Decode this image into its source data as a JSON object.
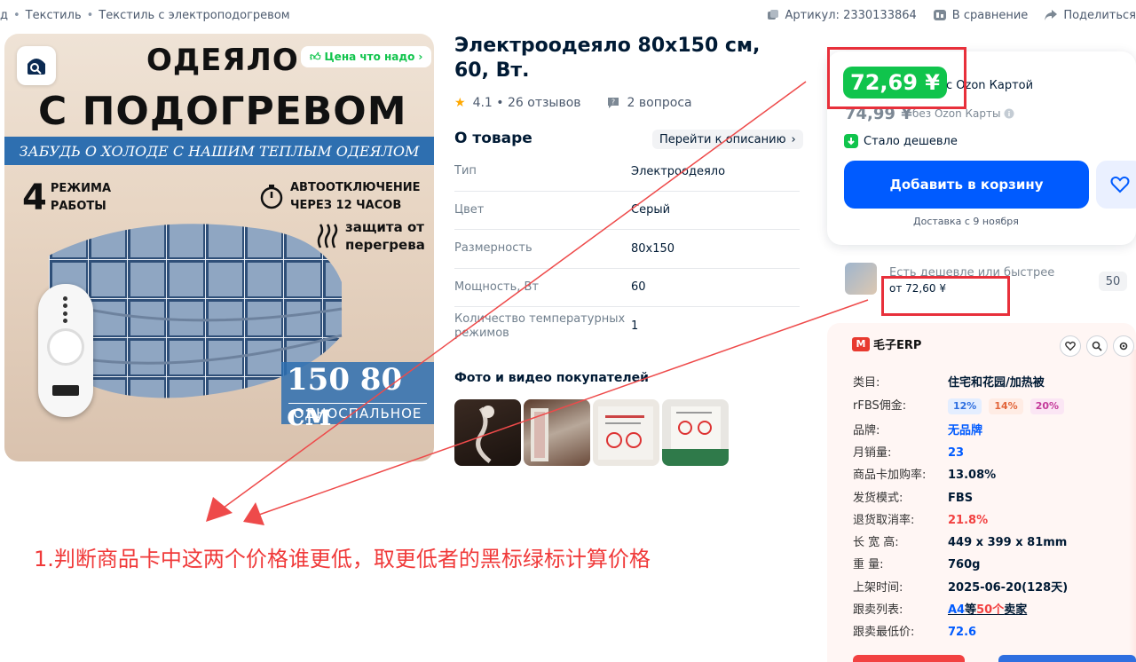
{
  "breadcrumb": {
    "items": [
      "д",
      "Текстиль",
      "Текстиль с электроподогревом"
    ]
  },
  "topbar": {
    "article": "Артикул: 2330133864",
    "compare": "В сравнение",
    "share": "Поделиться"
  },
  "hero": {
    "good_price": "Цена что надо",
    "headline_1": "ОДЕЯЛО",
    "headline_2": "С ПОДОГРЕВОМ",
    "band": "ЗАБУДЬ О ХОЛОДЕ С НАШИМ ТЕПЛЫМ ОДЕЯЛОМ",
    "modes_num": "4",
    "modes_text_1": "РЕЖИМА",
    "modes_text_2": "РАБОТЫ",
    "timer_1": "АВТООТКЛЮЧЕНИЕ",
    "timer_2": "ЧЕРЕЗ 12 ЧАСОВ",
    "protect_1": "защита от",
    "protect_2": "перегрева",
    "size": "150  80 см",
    "size_label": "ОДНОСПАЛЬНОЕ"
  },
  "product": {
    "title": "Электроодеяло 80х150 см, 60, Вт.",
    "rating": "4.1 • 26 отзывов",
    "questions": "2 вопроса",
    "about_heading": "О товаре",
    "to_description": "Перейти к описанию",
    "specs": [
      {
        "k": "Тип",
        "v": "Электроодеяло"
      },
      {
        "k": "Цвет",
        "v": "Серый"
      },
      {
        "k": "Размерность",
        "v": "80x150"
      },
      {
        "k": "Мощность, Вт",
        "v": "60"
      },
      {
        "k": "Количество температурных режимов",
        "v": "1"
      }
    ],
    "photos_heading": "Фото и видео покупателей"
  },
  "pricing": {
    "card_price": "72,69 ¥",
    "card_label": "с Ozon Картой",
    "old_price": "74,99 ¥",
    "old_label": "без Ozon Карты",
    "cheaper": "Стало дешевле",
    "add_to_cart": "Добавить в корзину",
    "delivery": "Доставка с 9 ноября"
  },
  "alternatives": {
    "title": "Есть дешевле или быстрее",
    "from_price": "от 72,60 ¥",
    "count": "50"
  },
  "erp": {
    "brand": "毛子ERP",
    "rows": [
      {
        "k": "类目:",
        "v": "住宅和花园/加热被"
      },
      {
        "k": "rFBS佣金:",
        "tags": [
          "12%",
          "14%",
          "20%"
        ]
      },
      {
        "k": "品牌:",
        "v": "无品牌"
      },
      {
        "k": "月销量:",
        "v": "23"
      },
      {
        "k": "商品卡加购率:",
        "v": "13.08%"
      },
      {
        "k": "发货模式:",
        "v": "FBS"
      },
      {
        "k": "退货取消率:",
        "v": "21.8%"
      },
      {
        "k": "长 宽 高:",
        "v": "449 x 399 x 81mm"
      },
      {
        "k": "重 量:",
        "v": "760g"
      },
      {
        "k": "上架时间:",
        "v": "2025-06-20(128天)"
      },
      {
        "k": "跟卖列表:",
        "v_a": "A4",
        "v_b": "等",
        "v_c": "50个",
        "v_d": "卖家"
      },
      {
        "k": "跟卖最低价:",
        "v": "72.6"
      }
    ]
  },
  "annotation": {
    "text": "1.判断商品卡中这两个价格谁更低，取更低者的黑标绿标计算价格"
  },
  "colors": {
    "ozon_blue": "#005bff",
    "price_green": "#10c44c",
    "annotation_red": "#f03a3a"
  }
}
